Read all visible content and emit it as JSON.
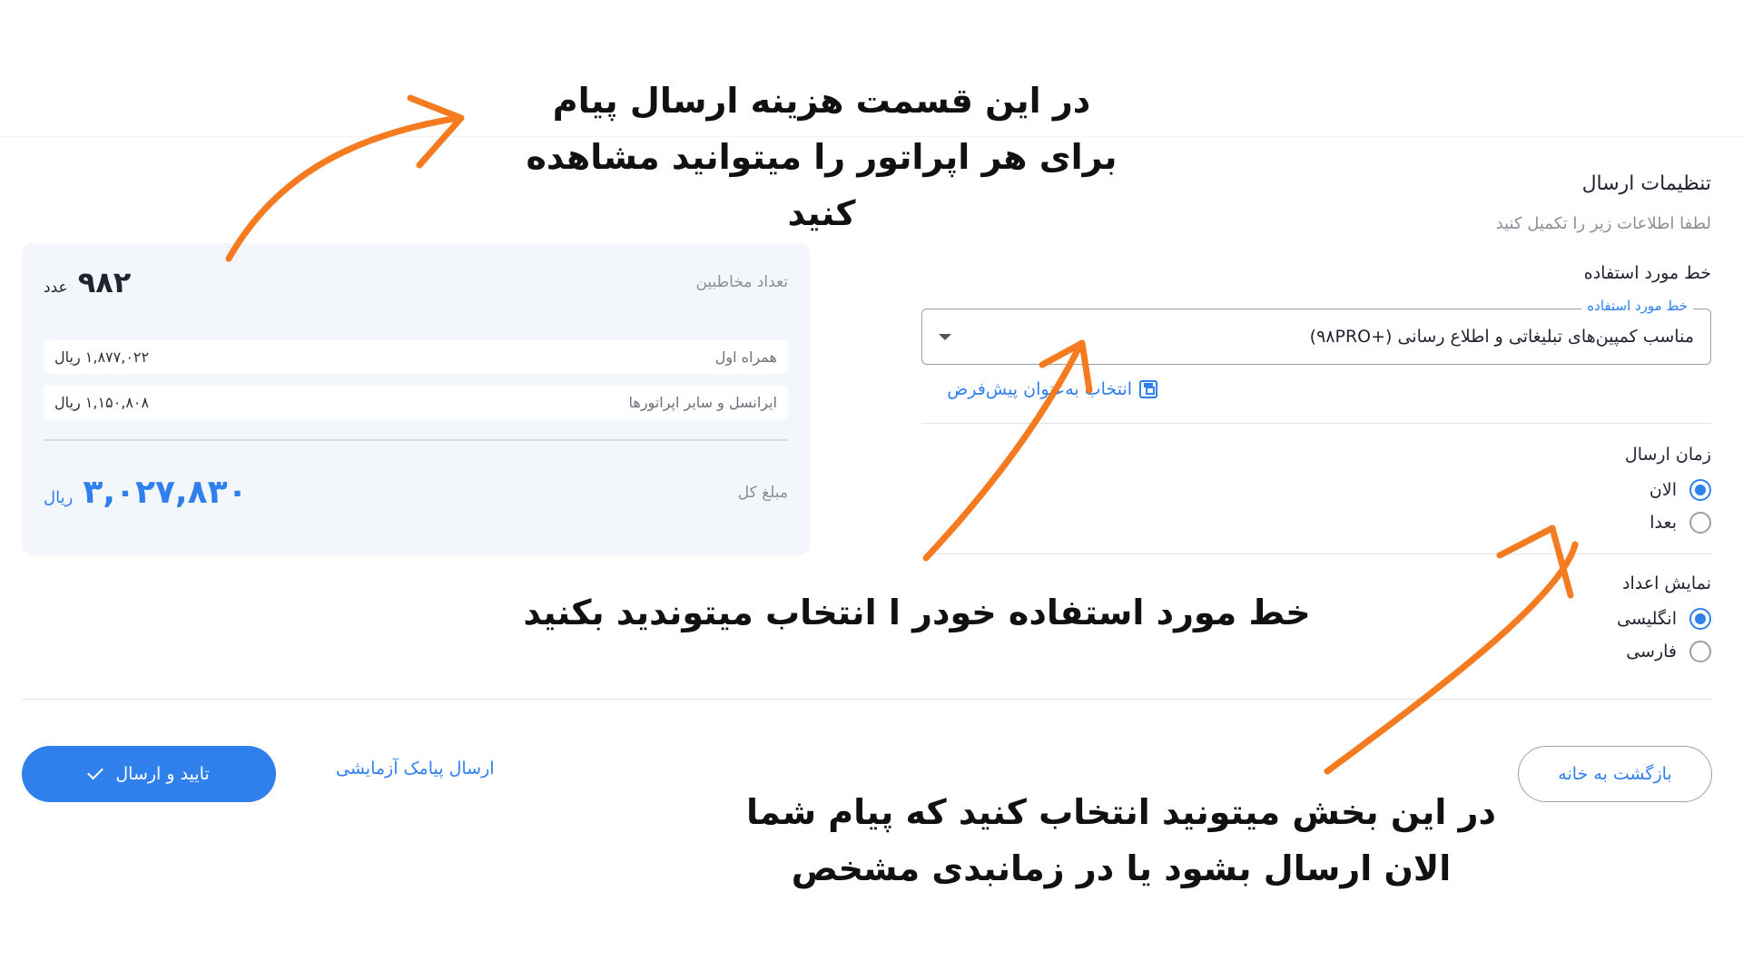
{
  "colors": {
    "accent": "#2f80ed",
    "arrow": "#f47b20",
    "card_bg": "#f3f6fb"
  },
  "annotations": {
    "top_line1": "در این قسمت هزینه ارسال پیام",
    "top_line2": "برای هر اپراتور را میتوانید مشاهده کنید",
    "middle": "خط مورد استفاده خودر ا انتخاب میتوندید بکنید",
    "bottom_line1": "در این بخش میتونید انتخاب کنید که پیام شما",
    "bottom_line2": "الان ارسال بشود یا در زمانبدی مشخص"
  },
  "summary": {
    "contacts_label": "تعداد مخاطبین",
    "contacts_value": "۹۸۲",
    "contacts_unit": "عدد",
    "operators": [
      {
        "label": "همراه اول",
        "value": "۱,۸۷۷,۰۲۲ ریال"
      },
      {
        "label": "ایرانسل و سایر اپراتورها",
        "value": "۱,۱۵۰,۸۰۸ ریال"
      }
    ],
    "total_label": "مبلغ کل",
    "total_value": "۳,۰۲۷,۸۳۰",
    "total_unit": "ریال"
  },
  "settings": {
    "title": "تنظیمات ارسال",
    "subtitle": "لطفا اطلاعات زیر را تکمیل کنید",
    "line_label": "خط مورد استفاده",
    "line_select": {
      "legend": "خط مورد استفاده",
      "value": "مناسب کمپین‌های تبلیغاتی و اطلاع رسانی (+۹۸PRO)",
      "icon": "chevron-down-icon"
    },
    "set_default": "انتخاب به‌عنوان پیش‌فرض",
    "send_time": {
      "label": "زمان ارسال",
      "options": [
        "الان",
        "بعدا"
      ],
      "selected": "الان"
    },
    "number_display": {
      "label": "نمایش اعداد",
      "options": [
        "انگلیسی",
        "فارسی"
      ],
      "selected": "انگلیسی"
    }
  },
  "footer": {
    "confirm": "تایید و ارسال",
    "test": "ارسال پیامک آزمایشی",
    "back": "بازگشت به خانه"
  }
}
